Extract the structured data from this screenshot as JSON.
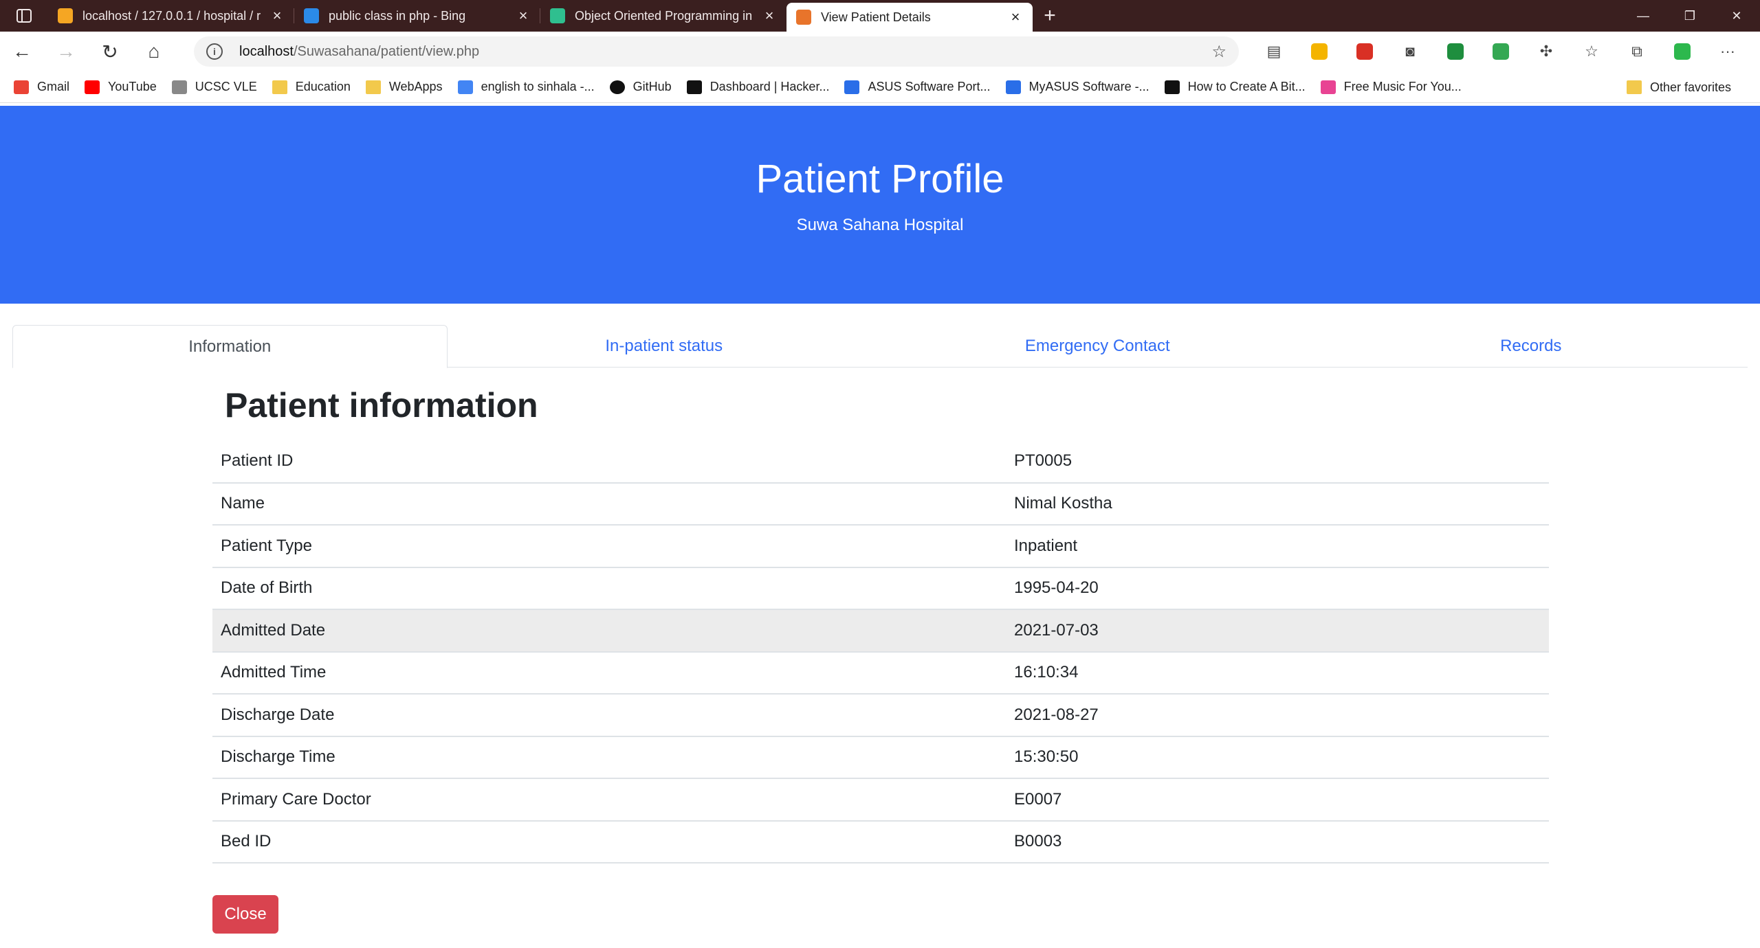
{
  "browser": {
    "tabs": [
      {
        "title": "localhost / 127.0.0.1 / hospital / r",
        "color": "#f5a623",
        "active": false
      },
      {
        "title": "public class in php - Bing",
        "color": "#2b8ae8",
        "active": false
      },
      {
        "title": "Object Oriented Programming in",
        "color": "#2fbf8f",
        "active": false
      },
      {
        "title": "View Patient Details",
        "color": "#e8742b",
        "active": true
      }
    ],
    "address": {
      "host": "localhost",
      "path": "/Suwasahana/patient/view.php"
    },
    "bookmarks": [
      {
        "label": "Gmail",
        "icon": "gmail-icon",
        "color": "#ea4335"
      },
      {
        "label": "YouTube",
        "icon": "youtube-icon",
        "color": "#ff0000"
      },
      {
        "label": "UCSC VLE",
        "icon": "ucsc-icon",
        "color": "#666666"
      },
      {
        "label": "Education",
        "icon": "folder-icon",
        "color": "#f2c94c"
      },
      {
        "label": "WebApps",
        "icon": "folder-icon",
        "color": "#f2c94c"
      },
      {
        "label": "english to sinhala -...",
        "icon": "google-icon",
        "color": "#4285f4"
      },
      {
        "label": "GitHub",
        "icon": "github-icon",
        "color": "#111111"
      },
      {
        "label": "Dashboard | Hacker...",
        "icon": "hackerrank-icon",
        "color": "#111111"
      },
      {
        "label": "ASUS Software Port...",
        "icon": "asus-icon",
        "color": "#2a6ee8"
      },
      {
        "label": "MyASUS Software -...",
        "icon": "asus-icon",
        "color": "#2a6ee8"
      },
      {
        "label": "How to Create A Bit...",
        "icon": "medium-icon",
        "color": "#111111"
      },
      {
        "label": "Free Music For You...",
        "icon": "music-icon",
        "color": "#e84393"
      }
    ],
    "other_favorites": "Other favorites"
  },
  "header": {
    "title": "Patient Profile",
    "subtitle": "Suwa Sahana Hospital"
  },
  "nav_tabs": [
    {
      "label": "Information",
      "active": true
    },
    {
      "label": "In-patient status",
      "active": false
    },
    {
      "label": "Emergency Contact",
      "active": false
    },
    {
      "label": "Records",
      "active": false
    }
  ],
  "section": {
    "title": "Patient information",
    "rows": [
      {
        "label": "Patient ID",
        "value": "PT0005"
      },
      {
        "label": "Name",
        "value": "Nimal Kostha"
      },
      {
        "label": "Patient Type",
        "value": "Inpatient"
      },
      {
        "label": "Date of Birth",
        "value": "1995-04-20"
      },
      {
        "label": "Admitted Date",
        "value": "2021-07-03"
      },
      {
        "label": "Admitted Time",
        "value": "16:10:34"
      },
      {
        "label": "Discharge Date",
        "value": "2021-08-27"
      },
      {
        "label": "Discharge Time",
        "value": "15:30:50"
      },
      {
        "label": "Primary Care Doctor",
        "value": "E0007"
      },
      {
        "label": "Bed ID",
        "value": "B0003"
      }
    ]
  },
  "actions": {
    "close_label": "Close"
  },
  "colors": {
    "brand": "#316cf4",
    "danger": "#d9434f",
    "tab_strip": "#3a1f1f"
  }
}
